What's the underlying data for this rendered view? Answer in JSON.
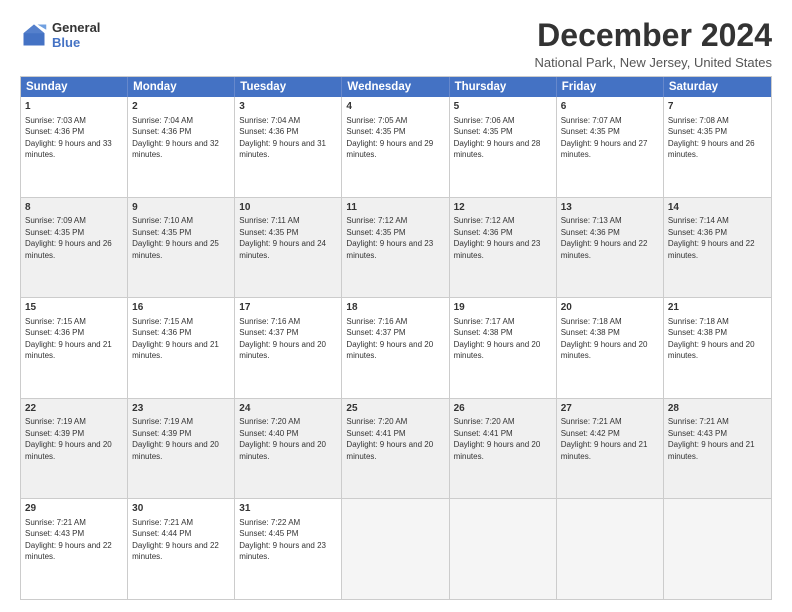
{
  "logo": {
    "line1": "General",
    "line2": "Blue"
  },
  "title": "December 2024",
  "subtitle": "National Park, New Jersey, United States",
  "header": {
    "days": [
      "Sunday",
      "Monday",
      "Tuesday",
      "Wednesday",
      "Thursday",
      "Friday",
      "Saturday"
    ]
  },
  "rows": [
    [
      {
        "day": "1",
        "sunrise": "7:03 AM",
        "sunset": "4:36 PM",
        "daylight": "9 hours and 33 minutes.",
        "empty": false,
        "shaded": false
      },
      {
        "day": "2",
        "sunrise": "7:04 AM",
        "sunset": "4:36 PM",
        "daylight": "9 hours and 32 minutes.",
        "empty": false,
        "shaded": false
      },
      {
        "day": "3",
        "sunrise": "7:04 AM",
        "sunset": "4:36 PM",
        "daylight": "9 hours and 31 minutes.",
        "empty": false,
        "shaded": false
      },
      {
        "day": "4",
        "sunrise": "7:05 AM",
        "sunset": "4:35 PM",
        "daylight": "9 hours and 29 minutes.",
        "empty": false,
        "shaded": false
      },
      {
        "day": "5",
        "sunrise": "7:06 AM",
        "sunset": "4:35 PM",
        "daylight": "9 hours and 28 minutes.",
        "empty": false,
        "shaded": false
      },
      {
        "day": "6",
        "sunrise": "7:07 AM",
        "sunset": "4:35 PM",
        "daylight": "9 hours and 27 minutes.",
        "empty": false,
        "shaded": false
      },
      {
        "day": "7",
        "sunrise": "7:08 AM",
        "sunset": "4:35 PM",
        "daylight": "9 hours and 26 minutes.",
        "empty": false,
        "shaded": false
      }
    ],
    [
      {
        "day": "8",
        "sunrise": "7:09 AM",
        "sunset": "4:35 PM",
        "daylight": "9 hours and 26 minutes.",
        "empty": false,
        "shaded": true
      },
      {
        "day": "9",
        "sunrise": "7:10 AM",
        "sunset": "4:35 PM",
        "daylight": "9 hours and 25 minutes.",
        "empty": false,
        "shaded": true
      },
      {
        "day": "10",
        "sunrise": "7:11 AM",
        "sunset": "4:35 PM",
        "daylight": "9 hours and 24 minutes.",
        "empty": false,
        "shaded": true
      },
      {
        "day": "11",
        "sunrise": "7:12 AM",
        "sunset": "4:35 PM",
        "daylight": "9 hours and 23 minutes.",
        "empty": false,
        "shaded": true
      },
      {
        "day": "12",
        "sunrise": "7:12 AM",
        "sunset": "4:36 PM",
        "daylight": "9 hours and 23 minutes.",
        "empty": false,
        "shaded": true
      },
      {
        "day": "13",
        "sunrise": "7:13 AM",
        "sunset": "4:36 PM",
        "daylight": "9 hours and 22 minutes.",
        "empty": false,
        "shaded": true
      },
      {
        "day": "14",
        "sunrise": "7:14 AM",
        "sunset": "4:36 PM",
        "daylight": "9 hours and 22 minutes.",
        "empty": false,
        "shaded": true
      }
    ],
    [
      {
        "day": "15",
        "sunrise": "7:15 AM",
        "sunset": "4:36 PM",
        "daylight": "9 hours and 21 minutes.",
        "empty": false,
        "shaded": false
      },
      {
        "day": "16",
        "sunrise": "7:15 AM",
        "sunset": "4:36 PM",
        "daylight": "9 hours and 21 minutes.",
        "empty": false,
        "shaded": false
      },
      {
        "day": "17",
        "sunrise": "7:16 AM",
        "sunset": "4:37 PM",
        "daylight": "9 hours and 20 minutes.",
        "empty": false,
        "shaded": false
      },
      {
        "day": "18",
        "sunrise": "7:16 AM",
        "sunset": "4:37 PM",
        "daylight": "9 hours and 20 minutes.",
        "empty": false,
        "shaded": false
      },
      {
        "day": "19",
        "sunrise": "7:17 AM",
        "sunset": "4:38 PM",
        "daylight": "9 hours and 20 minutes.",
        "empty": false,
        "shaded": false
      },
      {
        "day": "20",
        "sunrise": "7:18 AM",
        "sunset": "4:38 PM",
        "daylight": "9 hours and 20 minutes.",
        "empty": false,
        "shaded": false
      },
      {
        "day": "21",
        "sunrise": "7:18 AM",
        "sunset": "4:38 PM",
        "daylight": "9 hours and 20 minutes.",
        "empty": false,
        "shaded": false
      }
    ],
    [
      {
        "day": "22",
        "sunrise": "7:19 AM",
        "sunset": "4:39 PM",
        "daylight": "9 hours and 20 minutes.",
        "empty": false,
        "shaded": true
      },
      {
        "day": "23",
        "sunrise": "7:19 AM",
        "sunset": "4:39 PM",
        "daylight": "9 hours and 20 minutes.",
        "empty": false,
        "shaded": true
      },
      {
        "day": "24",
        "sunrise": "7:20 AM",
        "sunset": "4:40 PM",
        "daylight": "9 hours and 20 minutes.",
        "empty": false,
        "shaded": true
      },
      {
        "day": "25",
        "sunrise": "7:20 AM",
        "sunset": "4:41 PM",
        "daylight": "9 hours and 20 minutes.",
        "empty": false,
        "shaded": true
      },
      {
        "day": "26",
        "sunrise": "7:20 AM",
        "sunset": "4:41 PM",
        "daylight": "9 hours and 20 minutes.",
        "empty": false,
        "shaded": true
      },
      {
        "day": "27",
        "sunrise": "7:21 AM",
        "sunset": "4:42 PM",
        "daylight": "9 hours and 21 minutes.",
        "empty": false,
        "shaded": true
      },
      {
        "day": "28",
        "sunrise": "7:21 AM",
        "sunset": "4:43 PM",
        "daylight": "9 hours and 21 minutes.",
        "empty": false,
        "shaded": true
      }
    ],
    [
      {
        "day": "29",
        "sunrise": "7:21 AM",
        "sunset": "4:43 PM",
        "daylight": "9 hours and 22 minutes.",
        "empty": false,
        "shaded": false
      },
      {
        "day": "30",
        "sunrise": "7:21 AM",
        "sunset": "4:44 PM",
        "daylight": "9 hours and 22 minutes.",
        "empty": false,
        "shaded": false
      },
      {
        "day": "31",
        "sunrise": "7:22 AM",
        "sunset": "4:45 PM",
        "daylight": "9 hours and 23 minutes.",
        "empty": false,
        "shaded": false
      },
      {
        "day": "",
        "sunrise": "",
        "sunset": "",
        "daylight": "",
        "empty": true,
        "shaded": false
      },
      {
        "day": "",
        "sunrise": "",
        "sunset": "",
        "daylight": "",
        "empty": true,
        "shaded": false
      },
      {
        "day": "",
        "sunrise": "",
        "sunset": "",
        "daylight": "",
        "empty": true,
        "shaded": false
      },
      {
        "day": "",
        "sunrise": "",
        "sunset": "",
        "daylight": "",
        "empty": true,
        "shaded": false
      }
    ]
  ]
}
